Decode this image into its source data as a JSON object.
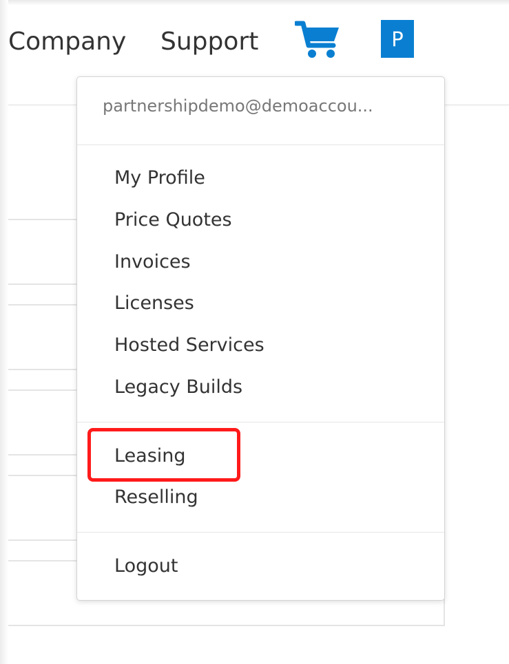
{
  "header": {
    "nav": {
      "company_label": "Company",
      "support_label": "Support"
    },
    "cart_icon": "shopping-cart-icon",
    "avatar_initial": "P",
    "brand_color": "#0a7fd1"
  },
  "account_menu": {
    "email": "partnershipdemo@demoaccou...",
    "groups": [
      [
        "My Profile",
        "Price Quotes",
        "Invoices",
        "Licenses",
        "Hosted Services",
        "Legacy Builds"
      ],
      [
        "Leasing",
        "Reselling"
      ],
      [
        "Logout"
      ]
    ],
    "highlighted_item": "Leasing",
    "highlight_color": "#ff1a1a"
  }
}
